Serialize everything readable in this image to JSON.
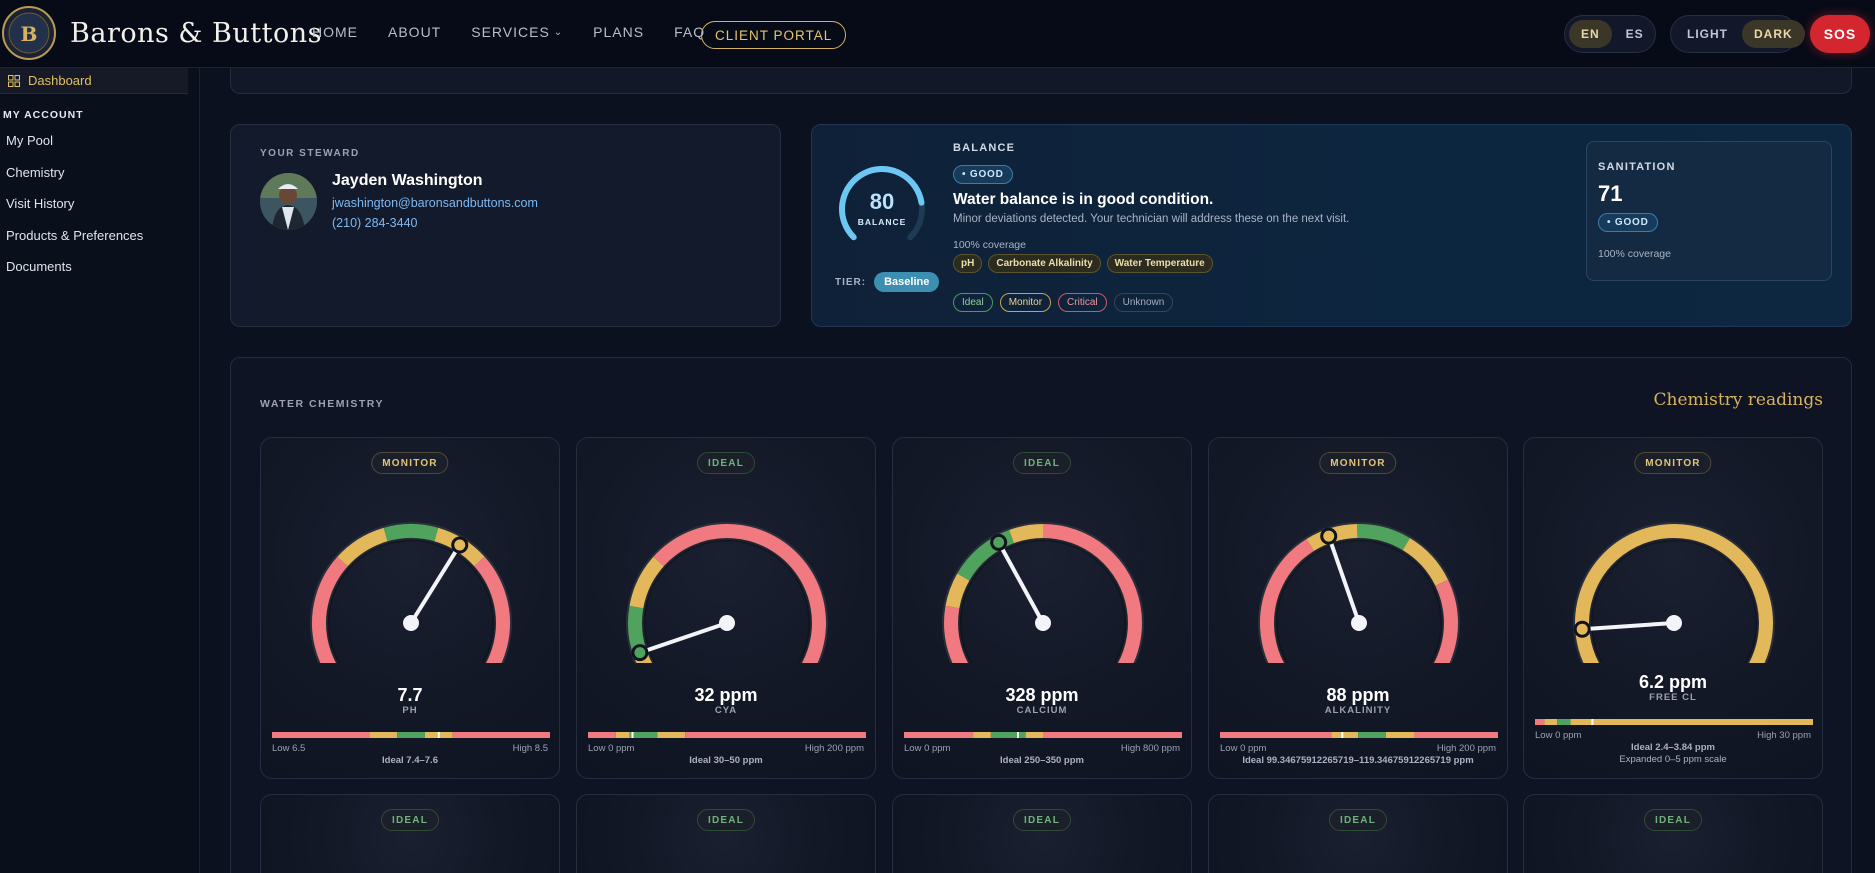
{
  "brand": {
    "name": "Barons & Buttons",
    "logo_icon": "crest-logo-icon"
  },
  "nav": {
    "items": [
      {
        "label": "HOME"
      },
      {
        "label": "ABOUT"
      },
      {
        "label": "SERVICES",
        "has_dropdown": true
      },
      {
        "label": "PLANS"
      },
      {
        "label": "FAQ"
      }
    ],
    "portal_label": "CLIENT PORTAL"
  },
  "language": {
    "options": [
      "EN",
      "ES"
    ],
    "selected": "EN"
  },
  "theme": {
    "options": [
      "LIGHT",
      "DARK"
    ],
    "selected": "DARK"
  },
  "sos_label": "SOS",
  "sidebar": {
    "active_item": "Dashboard",
    "section_title": "MY ACCOUNT",
    "items": [
      "My Pool",
      "Chemistry",
      "Visit History",
      "Products & Preferences",
      "Documents"
    ]
  },
  "steward": {
    "eyebrow": "YOUR STEWARD",
    "name": "Jayden Washington",
    "email": "jwashington@baronsandbuttons.com",
    "phone": "(210) 284-3440"
  },
  "balance": {
    "score": "80",
    "score_value": 80,
    "score_label": "BALANCE",
    "tier_label": "TIER:",
    "tier_value": "Baseline",
    "eyebrow": "BALANCE",
    "status": "• GOOD",
    "headline": "Water balance is in good condition.",
    "subtext": "Minor deviations detected. Your technician will address these on the next visit.",
    "coverage": "100% coverage",
    "tags": [
      "pH",
      "Carbonate Alkalinity",
      "Water Temperature"
    ],
    "legend": [
      "Ideal",
      "Monitor",
      "Critical",
      "Unknown"
    ],
    "sanitation": {
      "title": "SANITATION",
      "value": "71",
      "status": "• GOOD",
      "coverage": "100% coverage"
    }
  },
  "chemistry": {
    "eyebrow": "WATER CHEMISTRY",
    "link": "Chemistry readings",
    "colors": {
      "critical": "#f07a7f",
      "monitor": "#e3b85a",
      "ideal": "#4fa35c"
    },
    "gauges": [
      {
        "status": "MONITOR",
        "value": "7.7",
        "label": "PH",
        "low": "Low 6.5",
        "high": "High 8.5",
        "ideal": "Ideal 7.4–7.6",
        "min": 6.5,
        "max": 8.5,
        "reading": 7.7,
        "ideal_range": [
          7.4,
          7.6
        ],
        "monitor_range": [
          7.2,
          7.8
        ]
      },
      {
        "status": "IDEAL",
        "value": "32 ppm",
        "label": "CYA",
        "low": "Low 0 ppm",
        "high": "High 200 ppm",
        "ideal": "Ideal 30–50 ppm",
        "min": 0,
        "max": 200,
        "reading": 32,
        "ideal_range": [
          30,
          50
        ],
        "monitor_range": [
          20,
          70
        ]
      },
      {
        "status": "IDEAL",
        "value": "328 ppm",
        "label": "CALCIUM",
        "low": "Low 0 ppm",
        "high": "High 800 ppm",
        "ideal": "Ideal 250–350 ppm",
        "min": 0,
        "max": 800,
        "reading": 328,
        "ideal_range": [
          250,
          350
        ],
        "monitor_range": [
          200,
          400
        ]
      },
      {
        "status": "MONITOR",
        "value": "88 ppm",
        "label": "ALKALINITY",
        "low": "Low 0 ppm",
        "high": "High 200 ppm",
        "ideal": "Ideal 99.34675912265719–119.34675912265719 ppm",
        "min": 0,
        "max": 200,
        "reading": 88,
        "ideal_range": [
          99.35,
          119.35
        ],
        "monitor_range": [
          80,
          140
        ]
      },
      {
        "status": "MONITOR",
        "value": "6.2 ppm",
        "label": "FREE CL",
        "low": "Low 0 ppm",
        "high": "High 30 ppm",
        "ideal": "Ideal 2.4–3.84 ppm",
        "expanded": "Expanded 0–5 ppm scale",
        "min": 0,
        "max": 30,
        "reading": 6.2,
        "ideal_range": [
          2.4,
          3.84
        ],
        "monitor_range": [
          1,
          30
        ]
      }
    ],
    "second_row_status": [
      "IDEAL",
      "IDEAL",
      "IDEAL",
      "IDEAL",
      "IDEAL"
    ]
  }
}
